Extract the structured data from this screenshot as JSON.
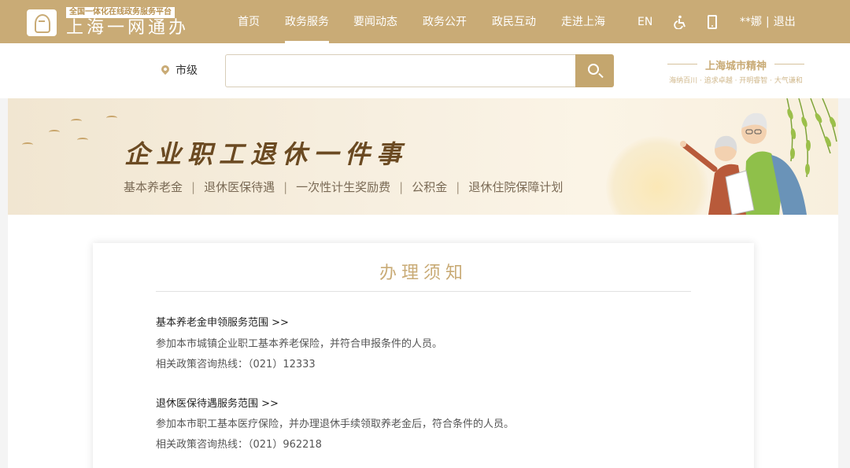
{
  "header": {
    "logo_tag": "全国一体化在线政务服务平台",
    "logo_name": "上海一网通办",
    "nav": [
      "首页",
      "政务服务",
      "要闻动态",
      "政务公开",
      "政民互动",
      "走进上海"
    ],
    "active_nav": "政务服务",
    "lang": "EN",
    "user_name": "**娜",
    "user_sep": "|",
    "logout": "退出"
  },
  "search": {
    "location": "市级",
    "placeholder": ""
  },
  "city_spirit": {
    "title": "上海城市精神",
    "subtitle": "海纳百川 · 追求卓越 · 开明睿智 · 大气谦和"
  },
  "banner": {
    "title": "企业职工退休一件事",
    "links": [
      "基本养老金",
      "退休医保待遇",
      "一次性计生奖励费",
      "公积金",
      "退休住院保障计划"
    ],
    "link_sep": "|"
  },
  "notice": {
    "title": "办理须知",
    "sections": [
      {
        "heading": "基本养老金申领服务范围 >>",
        "description": "参加本市城镇企业职工基本养老保险，并符合申报条件的人员。",
        "hotline": "相关政策咨询热线：（021）12333"
      },
      {
        "heading": "退休医保待遇服务范围 >>",
        "description": "参加本市职工基本医疗保险，并办理退休手续领取养老金后，符合条件的人员。",
        "hotline": "相关政策咨询热线：（021）962218"
      }
    ]
  },
  "colors": {
    "header_bg": "#c9ab76",
    "accent": "#c4a66e",
    "banner_title": "#6b4a22"
  }
}
